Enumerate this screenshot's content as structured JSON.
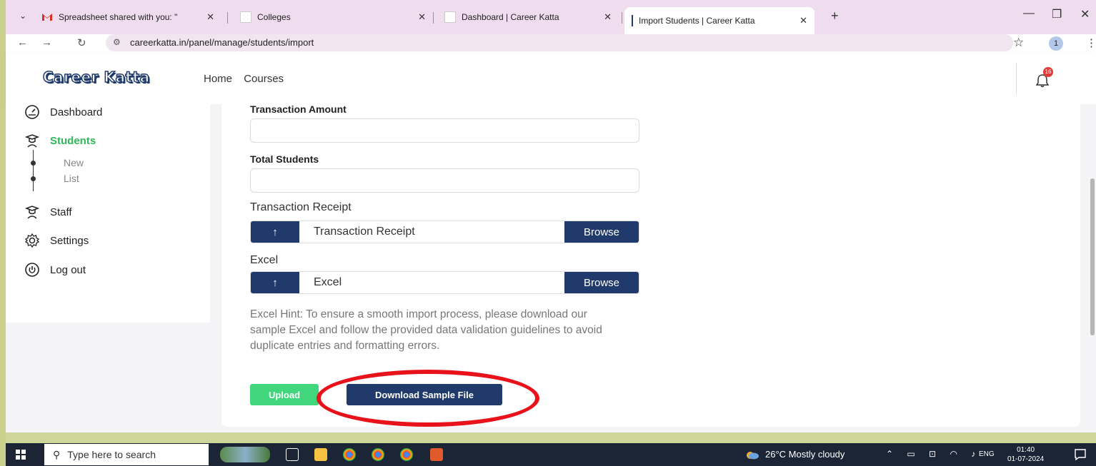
{
  "browser": {
    "tabs": [
      {
        "title": "Spreadsheet shared with you: \"",
        "favicon": "gmail-icon"
      },
      {
        "title": "Colleges",
        "favicon": "blank-icon"
      },
      {
        "title": "Dashboard | Career Katta",
        "favicon": "blank-icon"
      },
      {
        "title": "Import Students | Career Katta",
        "favicon": "blank-icon",
        "active": true
      }
    ],
    "url": "careerkatta.in/panel/manage/students/import",
    "profile_initial": "1"
  },
  "header": {
    "logo": "Career Katta",
    "nav": [
      "Home",
      "Courses"
    ],
    "notification_count": "16"
  },
  "sidebar": {
    "items": [
      {
        "label": "Dashboard",
        "icon": "dashboard-gauge-icon"
      },
      {
        "label": "Students",
        "icon": "student-icon",
        "active": true
      },
      {
        "label": "Staff",
        "icon": "staff-icon"
      },
      {
        "label": "Settings",
        "icon": "gear-icon"
      },
      {
        "label": "Log out",
        "icon": "power-icon"
      }
    ],
    "students_sub": [
      "New",
      "List"
    ]
  },
  "form": {
    "transaction_amount_label": "Transaction Amount",
    "total_students_label": "Total Students",
    "transaction_receipt_label": "Transaction Receipt",
    "transaction_receipt_placeholder": "Transaction Receipt",
    "excel_label": "Excel",
    "excel_placeholder": "Excel",
    "browse_label": "Browse",
    "upload_arrow": "↑",
    "hint": "Excel Hint: To ensure a smooth import process, please download our sample Excel and follow the provided data validation guidelines to avoid duplicate entries and formatting errors.",
    "upload_button": "Upload",
    "download_button": "Download Sample File"
  },
  "taskbar": {
    "search_placeholder": "Type here to search",
    "weather": "26°C  Mostly cloudy",
    "language": "ENG",
    "time": "01:40",
    "date": "01-07-2024"
  },
  "colors": {
    "brand_navy": "#1f3a6b",
    "active_green": "#2fb75a",
    "upload_green": "#41d67c",
    "highlight_red": "#e8121b"
  }
}
